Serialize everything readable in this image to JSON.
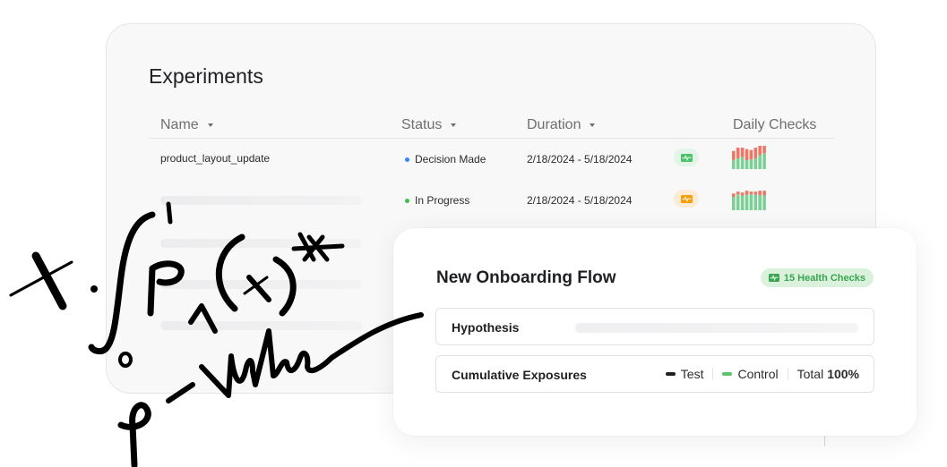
{
  "experiments": {
    "title": "Experiments",
    "columns": [
      {
        "label": "Name",
        "sortable": true
      },
      {
        "label": "Status",
        "sortable": true
      },
      {
        "label": "Duration",
        "sortable": true
      },
      {
        "label": "Daily Checks",
        "sortable": false
      }
    ],
    "rows": [
      {
        "name": "product_layout_update",
        "status": "Decision Made",
        "status_color": "#3b82f6",
        "duration": "2/18/2024 - 5/18/2024",
        "health_icon": "health-monitor-icon",
        "health_color": "#4cc06b",
        "health_bg": "#e3f5e6",
        "daily_checks": {
          "pass_fraction": [
            0.5,
            0.5,
            0.56,
            0.44,
            0.5,
            0.5,
            0.6,
            0.68
          ]
        }
      },
      {
        "name": "",
        "status": "In Progress",
        "status_color": "#3fbf4f",
        "duration": "2/18/2024 - 5/18/2024",
        "health_icon": "health-monitor-icon",
        "health_color": "#f59e0b",
        "health_bg": "#fdebd6",
        "daily_checks": {
          "pass_fraction": [
            0.8,
            0.85,
            0.82,
            0.8,
            0.85,
            0.83,
            0.78,
            0.75
          ]
        }
      }
    ]
  },
  "onboarding": {
    "title": "New Onboarding Flow",
    "health_badge": "15 Health Checks",
    "hypothesis_label": "Hypothesis",
    "exposures_label": "Cumulative Exposures",
    "legend": {
      "test_label": "Test",
      "test_color": "#1f2023",
      "control_label": "Control",
      "control_color": "#5cc36a",
      "total_label": "Total",
      "total_value": "100%"
    }
  },
  "annotation": {
    "handwritten_text": "x·∫₀¹ p_A(x)* p-value"
  },
  "colors": {
    "bar_pass": "#7ccf95",
    "bar_fail": "#ec7766"
  }
}
